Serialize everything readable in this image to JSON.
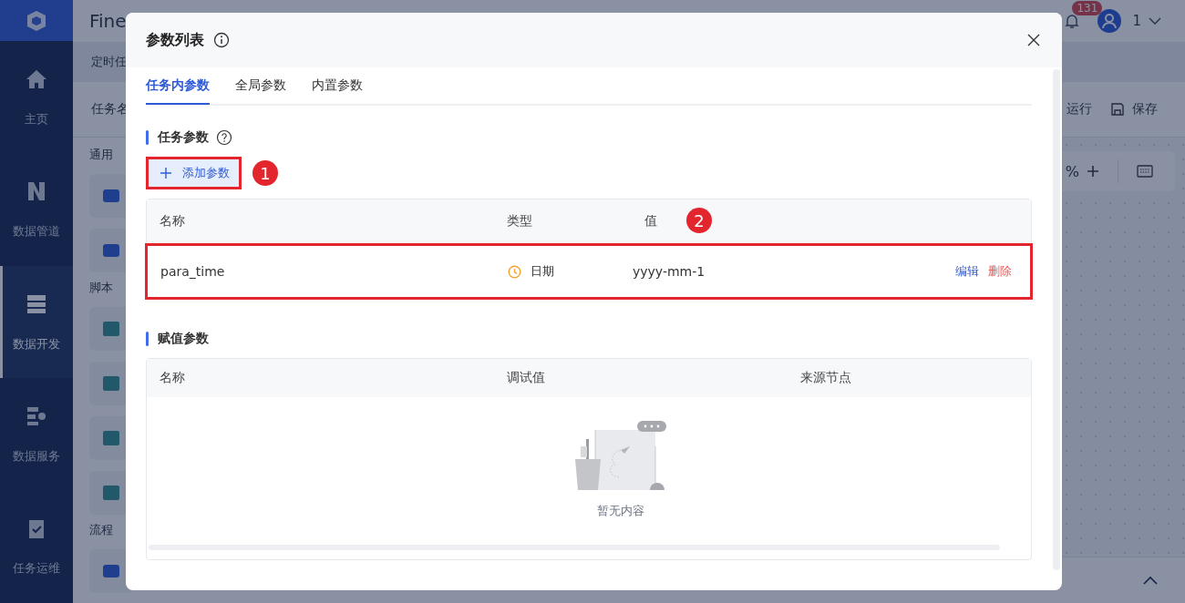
{
  "app": {
    "product": "Fine",
    "notifications": "131",
    "user": "1"
  },
  "sidebar": {
    "items": [
      {
        "label": "主页",
        "selected": false
      },
      {
        "label": "数据管道",
        "selected": false
      },
      {
        "label": "数据开发",
        "selected": true
      },
      {
        "label": "数据服务",
        "selected": false
      },
      {
        "label": "任务运维",
        "selected": false
      }
    ]
  },
  "workspace": {
    "tab": "定时任",
    "task_label": "任务名",
    "toolbar": [
      {
        "label": "运行"
      },
      {
        "label": "保存"
      }
    ],
    "zoom": "%",
    "palette": [
      {
        "heading": "通用"
      },
      {
        "heading": "脚本"
      },
      {
        "heading": "流程"
      }
    ]
  },
  "dialog": {
    "title": "参数列表",
    "tabs": [
      {
        "label": "任务内参数",
        "selected": true
      },
      {
        "label": "全局参数",
        "selected": false
      },
      {
        "label": "内置参数",
        "selected": false
      }
    ],
    "task_params": {
      "title": "任务参数",
      "add_button": {
        "label": "添加参数",
        "highlighted": true
      },
      "columns": [
        "名称",
        "类型",
        "值"
      ],
      "rows": [
        {
          "name": "para_time",
          "type": "日期",
          "value": "yyyy-mm-1",
          "highlighted": true,
          "actions": [
            {
              "label": "编辑",
              "kind": "edit"
            },
            {
              "label": "删除",
              "kind": "delete"
            }
          ]
        }
      ]
    },
    "assign_params": {
      "title": "赋值参数",
      "columns": [
        "名称",
        "调试值",
        "来源节点"
      ],
      "empty_text": "暂无内容"
    }
  },
  "annotations": [
    {
      "label": "1"
    },
    {
      "label": "2"
    }
  ]
}
